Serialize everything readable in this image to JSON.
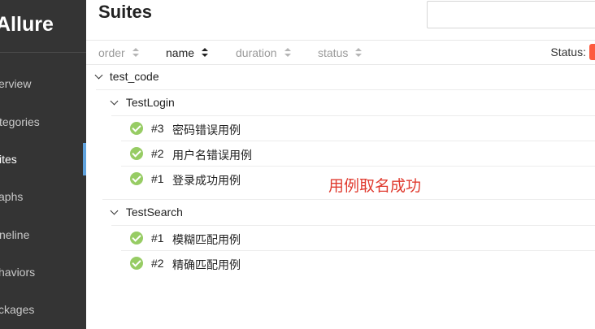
{
  "sidebar": {
    "brand": "Allure",
    "items": [
      {
        "label": "Overview",
        "visible": "erview"
      },
      {
        "label": "Categories",
        "visible": "tegories"
      },
      {
        "label": "Suites",
        "visible": "ites"
      },
      {
        "label": "Graphs",
        "visible": "aphs"
      },
      {
        "label": "Timeline",
        "visible": "neline"
      },
      {
        "label": "Behaviors",
        "visible": "haviors"
      },
      {
        "label": "Packages",
        "visible": "ckages"
      }
    ],
    "active_item": "Suites",
    "accent_color": "#5fa2dd"
  },
  "main": {
    "title": "Suites",
    "search": {
      "value": "",
      "placeholder": ""
    },
    "columns": [
      {
        "label": "order",
        "sort_icon": "sort-icon"
      },
      {
        "label": "name",
        "sort_icon": "sort-icon"
      },
      {
        "label": "duration",
        "sort_icon": "sort-icon"
      },
      {
        "label": "status",
        "sort_icon": "sort-icon"
      }
    ],
    "status_label": "Status:",
    "tree": {
      "root": "test_code",
      "groups": [
        {
          "name": "TestLogin",
          "cases": [
            {
              "num": "#3",
              "name": "密码错误用例",
              "status": "passed"
            },
            {
              "num": "#2",
              "name": "用户名错误用例",
              "status": "passed"
            },
            {
              "num": "#1",
              "name": "登录成功用例",
              "status": "passed"
            }
          ]
        },
        {
          "name": "TestSearch",
          "cases": [
            {
              "num": "#1",
              "name": "模糊匹配用例",
              "status": "passed"
            },
            {
              "num": "#2",
              "name": "精确匹配用例",
              "status": "passed"
            }
          ]
        }
      ]
    },
    "annotation": "用例取名成功",
    "colors": {
      "passed": "#97cc64",
      "annotation": "#e03b2f",
      "sidebar_bg": "#343434"
    }
  }
}
